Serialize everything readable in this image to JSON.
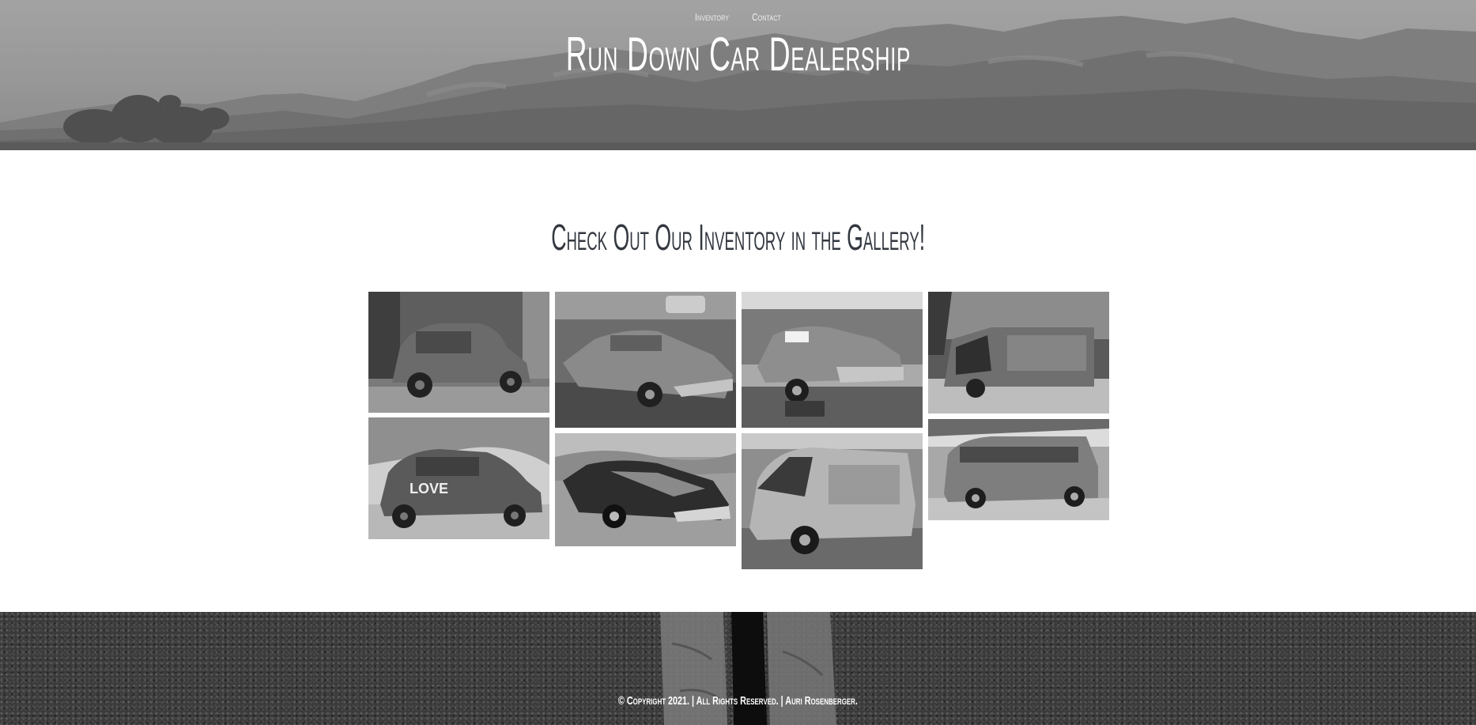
{
  "nav": {
    "items": [
      {
        "label": "Inventory"
      },
      {
        "label": "Contact"
      }
    ]
  },
  "header": {
    "title": "Run Down Car Dealership"
  },
  "gallery": {
    "heading": "Check Out Our Inventory in the Gallery!",
    "photos": [
      {
        "subject": "small hatchback car"
      },
      {
        "subject": "classic sedan"
      },
      {
        "subject": "coupe on blocks"
      },
      {
        "subject": "abandoned van in woods"
      },
      {
        "subject": "painted love hatchback"
      },
      {
        "subject": "muscle car"
      },
      {
        "subject": "wrecked van"
      },
      {
        "subject": "painted van"
      }
    ]
  },
  "footer": {
    "copyright": "© Copyright 2021. | All Rights Reserved. | Auri Rosenberger."
  },
  "colors": {
    "header_bg": "#979797",
    "heading_text": "#333840",
    "footer_bg": "#3a3a3a"
  }
}
